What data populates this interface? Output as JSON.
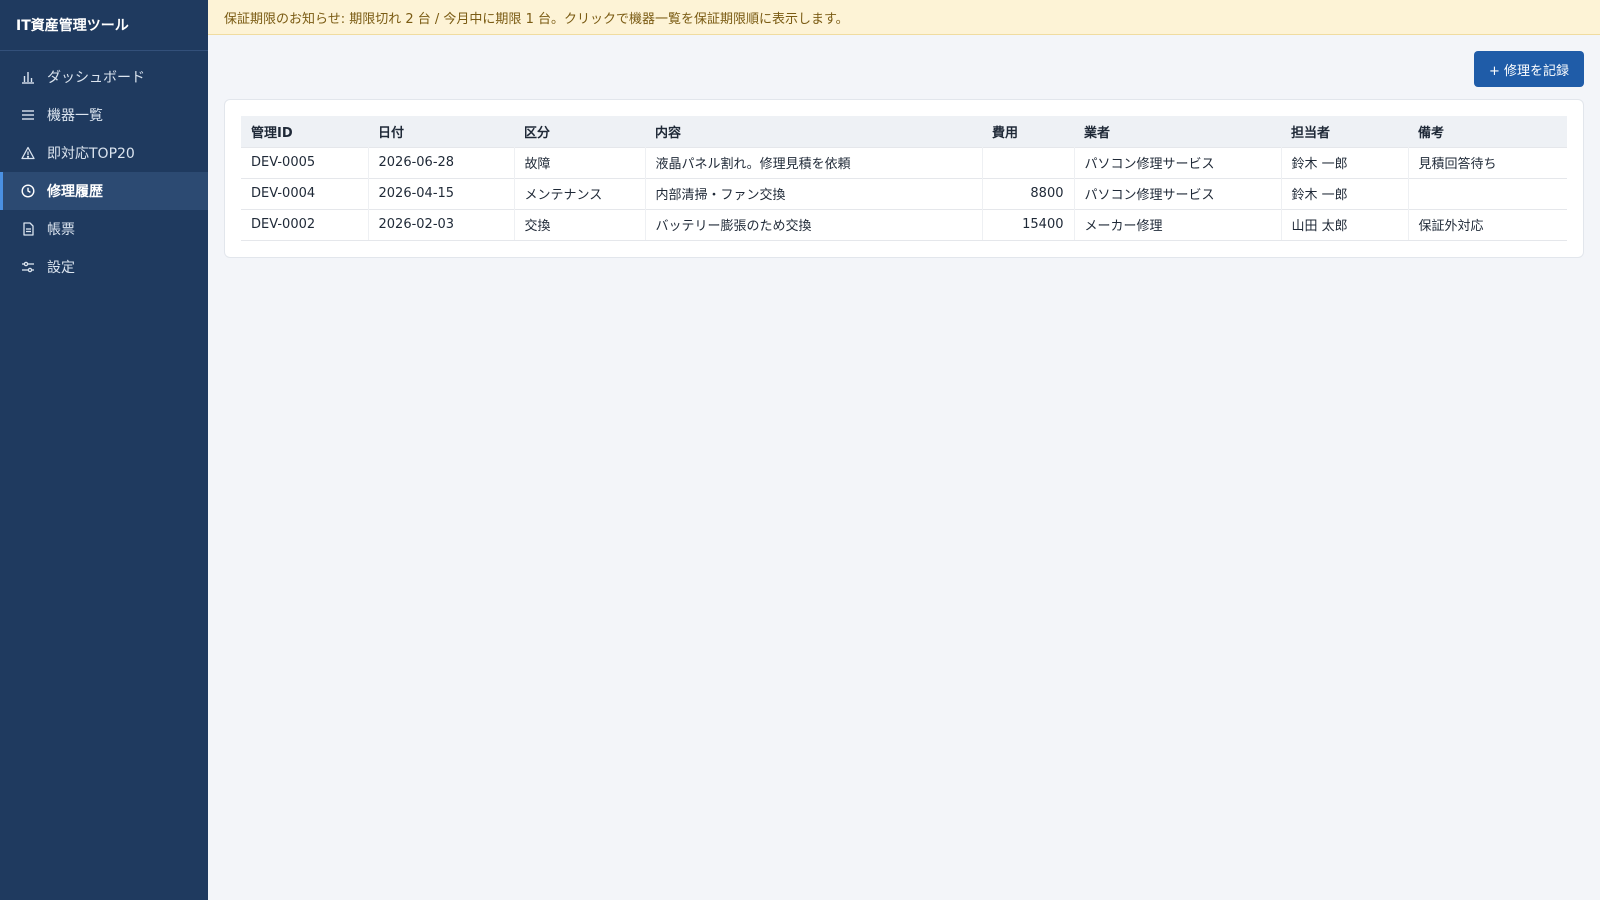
{
  "app": {
    "title": "IT資産管理ツール"
  },
  "sidebar": {
    "items": [
      {
        "label": "ダッシュボード",
        "icon": "bar-chart-icon",
        "active": false
      },
      {
        "label": "機器一覧",
        "icon": "list-icon",
        "active": false
      },
      {
        "label": "即対応TOP20",
        "icon": "warning-icon",
        "active": false
      },
      {
        "label": "修理履歴",
        "icon": "clock-icon",
        "active": true
      },
      {
        "label": "帳票",
        "icon": "document-icon",
        "active": false
      },
      {
        "label": "設定",
        "icon": "sliders-icon",
        "active": false
      }
    ]
  },
  "notice": {
    "text": "保証期限のお知らせ: 期限切れ 2 台 / 今月中に期限 1 台。クリックで機器一覧を保証期限順に表示します。"
  },
  "toolbar": {
    "add_label": "+ 修理を記録"
  },
  "table": {
    "headers": [
      "管理ID",
      "日付",
      "区分",
      "内容",
      "費用",
      "業者",
      "担当者",
      "備考"
    ],
    "rows": [
      [
        "DEV-0005",
        "2026-06-28",
        "故障",
        "液晶パネル割れ。修理見積を依頼",
        "",
        "パソコン修理サービス",
        "鈴木 一郎",
        "見積回答待ち"
      ],
      [
        "DEV-0004",
        "2026-04-15",
        "メンテナンス",
        "内部清掃・ファン交換",
        "8800",
        "パソコン修理サービス",
        "鈴木 一郎",
        ""
      ],
      [
        "DEV-0002",
        "2026-02-03",
        "交換",
        "バッテリー膨張のため交換",
        "15400",
        "メーカー修理",
        "山田 太郎",
        "保証外対応"
      ]
    ]
  },
  "colors": {
    "sidebar_bg": "#1f3a5f",
    "active_item_bg": "#2c4a72",
    "primary_button": "#1f5ca8",
    "notice_bg": "#fdf3d6",
    "notice_text": "#7a5b13"
  }
}
